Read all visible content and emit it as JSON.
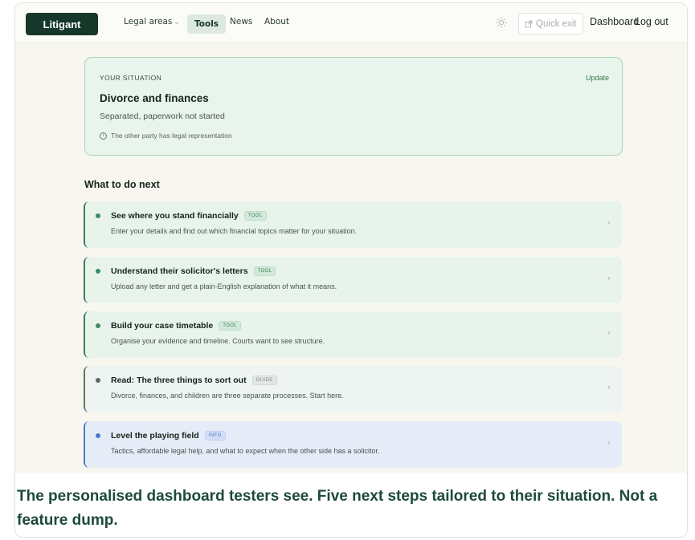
{
  "nav": {
    "logo": "Litigant",
    "legal_areas": "Legal areas",
    "tools": "Tools",
    "news": "News",
    "about": "About",
    "quick_exit": "Quick exit",
    "dashboard": "Dashboard",
    "logout": "Log out"
  },
  "situation": {
    "label": "YOUR SITUATION",
    "update": "Update",
    "title": "Divorce and finances",
    "subtitle": "Separated, paperwork not started",
    "note": "The other party has legal representation"
  },
  "next": {
    "heading": "What to do next",
    "steps": [
      {
        "title": "See where you stand financially",
        "badge": "TOOL",
        "kind": "tool",
        "description": "Enter your details and find out which financial topics matter for your situation."
      },
      {
        "title": "Understand their solicitor's letters",
        "badge": "TOOL",
        "kind": "tool",
        "description": "Upload any letter and get a plain-English explanation of what it means."
      },
      {
        "title": "Build your case timetable",
        "badge": "TOOL",
        "kind": "tool",
        "description": "Organise your evidence and timeline. Courts want to see structure."
      },
      {
        "title": "Read: The three things to sort out",
        "badge": "GUIDE",
        "kind": "guide",
        "description": "Divorce, finances, and children are three separate processes. Start here."
      },
      {
        "title": "Level the playing field",
        "badge": "INFO",
        "kind": "info",
        "description": "Tactics, affordable legal help, and what to expect when the other side has a solicitor."
      }
    ]
  },
  "caption": "The personalised dashboard testers see. Five next steps tailored to their situation. Not a feature dump.",
  "colors": {
    "brand": "#15382b",
    "tool_accent": "#3d7b57",
    "guide_accent": "#69726d",
    "info_accent": "#4f78c9",
    "caption": "#1d4a3a"
  }
}
